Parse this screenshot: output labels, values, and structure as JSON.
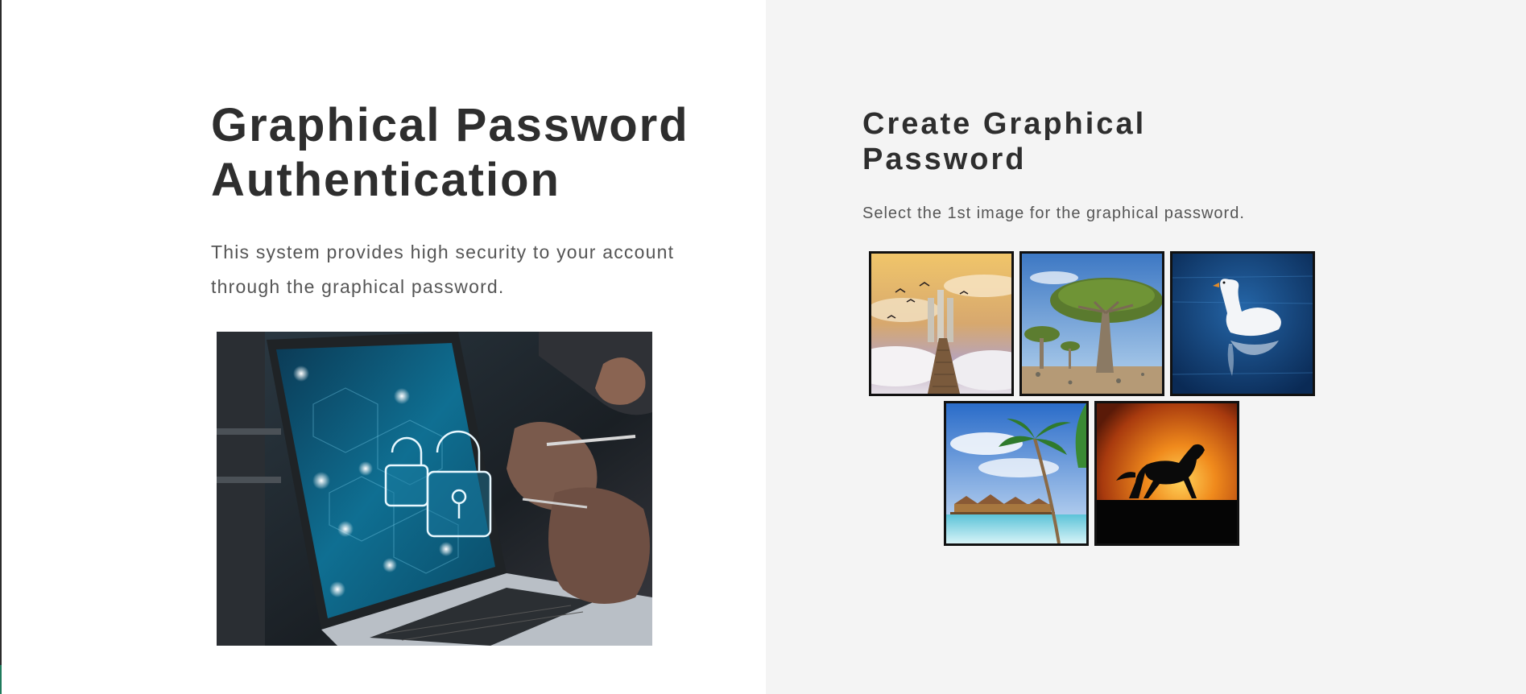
{
  "intro": {
    "title": "Graphical Password Authentication",
    "description": "This system provides high security to your account through the graphical password.",
    "hero_image": "laptop-padlock-security-image"
  },
  "create": {
    "title": "Create Graphical Password",
    "instruction": "Select the 1st image for the graphical password.",
    "images": [
      {
        "subject": "birds-over-clouds-staircase-image"
      },
      {
        "subject": "dragon-tree-image"
      },
      {
        "subject": "white-swan-image"
      },
      {
        "subject": "palm-beach-huts-image"
      },
      {
        "subject": "horse-silhouette-sunset-image"
      }
    ]
  },
  "colors": {
    "left_background": "#ffffff",
    "right_background": "#f4f4f4",
    "heading_text": "#2e2e2e",
    "body_text": "#555555",
    "tile_border": "#111111"
  }
}
